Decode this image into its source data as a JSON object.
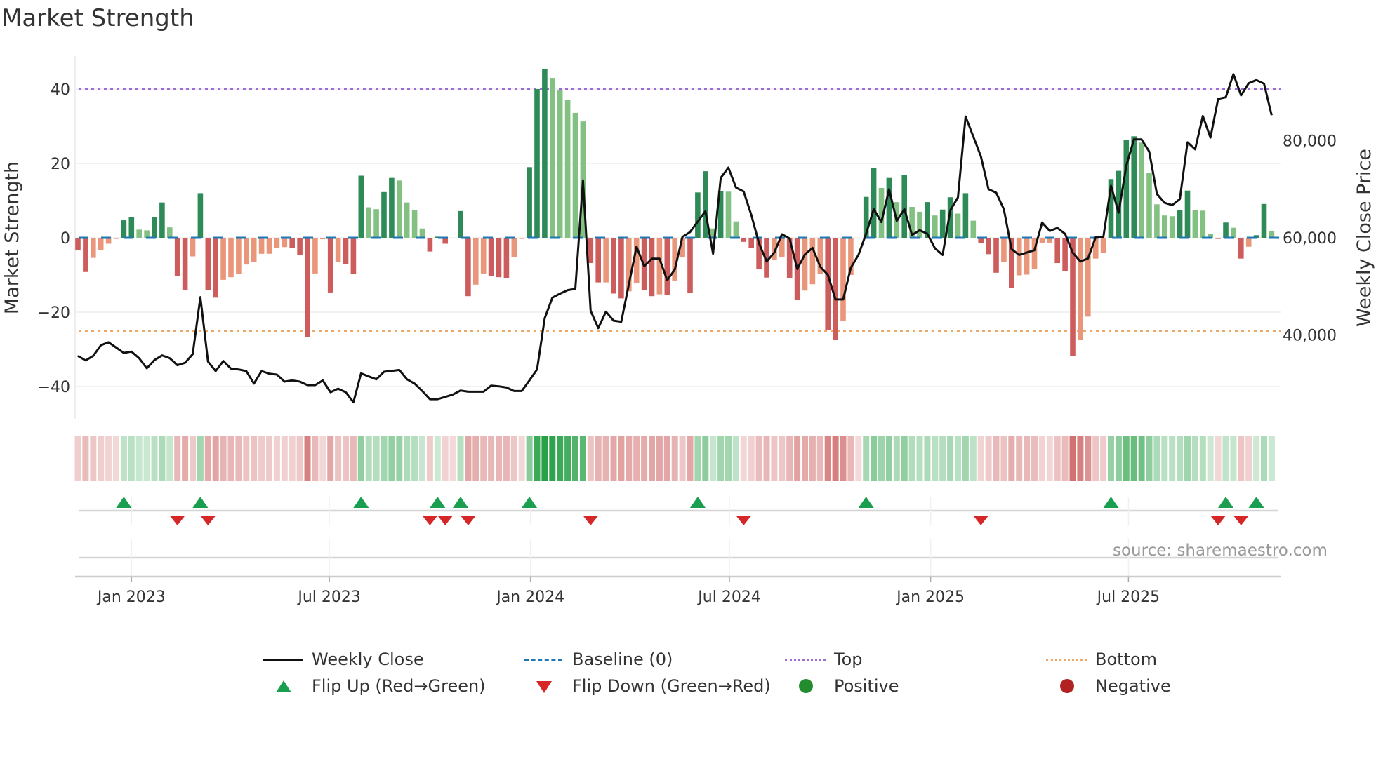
{
  "title": "Market Strength",
  "source": "source: sharemaestro.com",
  "legend": {
    "weekly_close": "Weekly Close",
    "baseline": "Baseline (0)",
    "top": "Top",
    "bottom": "Bottom",
    "flip_up": "Flip Up (Red→Green)",
    "flip_down": "Flip Down (Green→Red)",
    "positive": "Positive",
    "negative": "Negative"
  },
  "colors": {
    "dark_green": "#2e8b57",
    "light_green": "#82c182",
    "dark_red": "#cd5c5c",
    "light_red": "#e9967a",
    "baseline": "#1f77b4",
    "top": "#9b6bd6",
    "bottom": "#f0a868",
    "flip_up": "#1a9e50",
    "flip_down": "#d62728",
    "price": "#111111"
  },
  "chart_data": {
    "type": "bar+line",
    "title": "Market Strength",
    "ylabel": "Market Strength",
    "y2label": "Weekly Close Price",
    "first_week": "2022-11-13",
    "ylim": [
      -49,
      49
    ],
    "yticks": [
      40,
      20,
      0,
      -20,
      -40
    ],
    "ytick_labels": [
      "40",
      "20",
      "0",
      "−20",
      "−40"
    ],
    "y2ticks": [
      80000,
      60000,
      40000
    ],
    "y2tick_labels": [
      "80,000",
      "60,000",
      "40,000"
    ],
    "top_level": 40,
    "bottom_level": -25,
    "xticks": [
      {
        "date": "2023-01-01",
        "label": "Jan 2023"
      },
      {
        "date": "2023-07-01",
        "label": "Jul 2023"
      },
      {
        "date": "2024-01-01",
        "label": "Jan 2024"
      },
      {
        "date": "2024-07-01",
        "label": "Jul 2024"
      },
      {
        "date": "2025-01-01",
        "label": "Jan 2025"
      },
      {
        "date": "2025-07-01",
        "label": "Jul 2025"
      }
    ],
    "strength": [
      -3.4,
      -9.2,
      -5.4,
      -3.2,
      -1.6,
      -0.3,
      4.7,
      5.5,
      2.2,
      2.0,
      5.5,
      9.5,
      2.8,
      -10.3,
      -14,
      -5,
      12,
      -14.1,
      -16.1,
      -11.3,
      -10.6,
      -9.7,
      -7.2,
      -6.6,
      -4.3,
      -4.3,
      -2.8,
      -2.5,
      -2.7,
      -4.7,
      -26.6,
      -9.6,
      -0.4,
      -14.7,
      -6.6,
      -7,
      -9.8,
      16.7,
      8.2,
      7.7,
      12.3,
      16.1,
      15.4,
      9.5,
      7.5,
      2.5,
      -3.7,
      0.3,
      -1.6,
      -0.2,
      7.2,
      -15.7,
      -12.6,
      -9.6,
      -10.3,
      -10.6,
      -10.8,
      -5.1,
      -0.3,
      19,
      40,
      45.4,
      43,
      39.8,
      37,
      33.6,
      31.3,
      -6.8,
      -12,
      -12,
      -15,
      -16.3,
      -14.4,
      -12.1,
      -14.1,
      -15.7,
      -15.2,
      -15.4,
      -11.5,
      -5.3,
      -14.9,
      12.2,
      17.9,
      2.5,
      12.5,
      12.4,
      4.4,
      -1.1,
      -2.8,
      -8.5,
      -10.7,
      -5.9,
      -5.1,
      -10.8,
      -16.6,
      -14.2,
      -12.5,
      -9.7,
      -24.9,
      -27.5,
      -22.3,
      -10,
      -0.2,
      11,
      18.7,
      13.4,
      16.1,
      9.6,
      16.8,
      8.3,
      7,
      9.6,
      6,
      7.6,
      10.9,
      6.5,
      12,
      4.6,
      -1.5,
      -4.4,
      -9.4,
      -6.5,
      -13.4,
      -10.1,
      -9.9,
      -8.4,
      -1.5,
      -1.3,
      -6.8,
      -8.9,
      -31.7,
      -27.4,
      -21.2,
      -5.6,
      -4,
      15.8,
      18,
      26.3,
      27.3,
      25.6,
      17.5,
      9,
      6,
      5.8,
      7.4,
      12.7,
      7.5,
      7.3,
      1,
      -0.3,
      4.1,
      2.7,
      -5.6,
      -2.4,
      0.7,
      9.1,
      1.9
    ],
    "weekly_close": [
      35700,
      34740,
      35700,
      37880,
      38500,
      37400,
      36300,
      36580,
      35220,
      33140,
      34830,
      35800,
      35220,
      33770,
      34260,
      36040,
      47780,
      34500,
      32570,
      34640,
      33050,
      32900,
      32570,
      30000,
      32570,
      32030,
      31840,
      30390,
      30640,
      30390,
      29670,
      29670,
      30640,
      28220,
      28940,
      28220,
      26140,
      32080,
      31450,
      30870,
      32420,
      32610,
      32800,
      30870,
      30000,
      28460,
      26770,
      26770,
      27250,
      27740,
      28560,
      28320,
      28320,
      28320,
      29570,
      29430,
      29190,
      28460,
      28460,
      30640,
      32900,
      43430,
      47680,
      48500,
      49230,
      49470,
      71830,
      44980,
      41400,
      44790,
      42950,
      42710,
      50440,
      58160,
      54160,
      55700,
      55700,
      51260,
      53480,
      60190,
      61200,
      63330,
      65460,
      56720,
      72320,
      74440,
      70340,
      69520,
      64690,
      58890,
      55120,
      56960,
      60720,
      59860,
      53580,
      56570,
      57920,
      54060,
      52370,
      47300,
      47300,
      53820,
      56470,
      60820,
      65890,
      63240,
      70000,
      63480,
      65890,
      60580,
      61550,
      60820,
      57830,
      56470,
      65650,
      68310,
      84970,
      80870,
      76760,
      70000,
      69270,
      65890,
      57680,
      56470,
      56960,
      57440,
      63140,
      61400,
      62030,
      60820,
      56960,
      55120,
      55750,
      60100,
      60100,
      70720,
      65170,
      74830,
      80240,
      80240,
      77730,
      69030,
      67200,
      66710,
      67970,
      79660,
      78210,
      85070,
      80620,
      88590,
      88930,
      93670,
      89320,
      91830,
      92460,
      91730,
      85210
    ]
  }
}
